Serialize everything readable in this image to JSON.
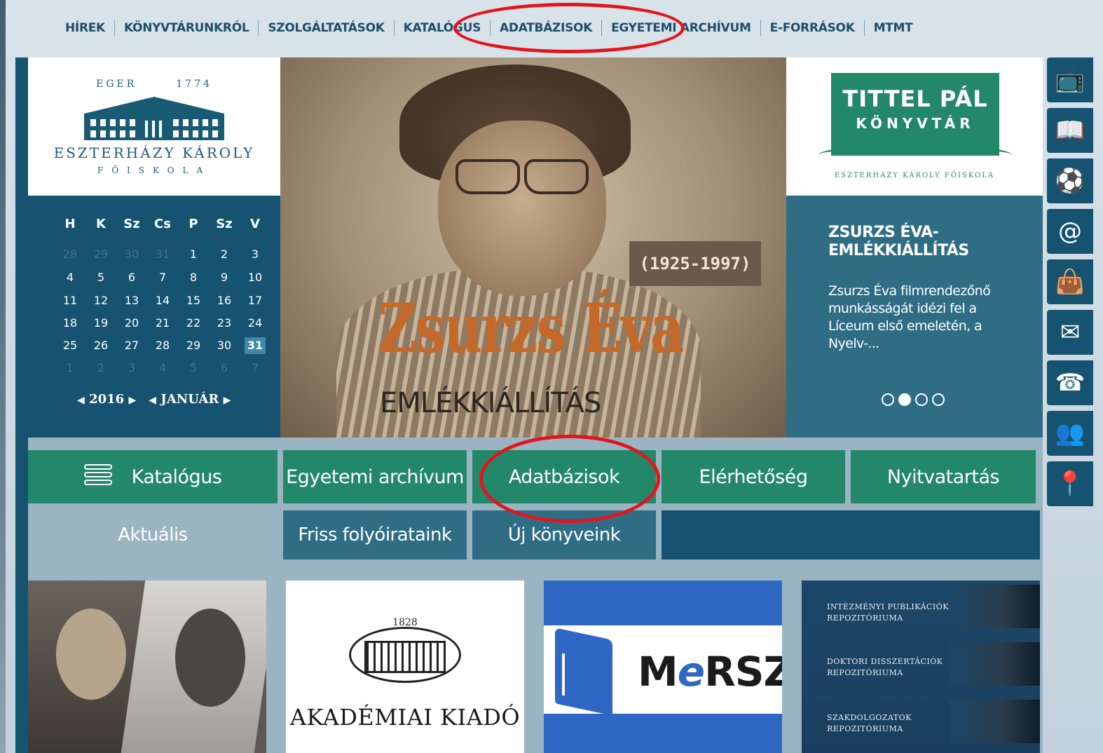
{
  "topnav": {
    "items": [
      "HÍREK",
      "KÖNYVTÁRUNKRÓL",
      "SZOLGÁLTATÁSOK",
      "KATALÓGUS",
      "ADATBÁZISOK",
      "EGYETEMI ARCHÍVUM",
      "E-FORRÁSOK",
      "MTMT"
    ]
  },
  "logo": {
    "city": "EGER",
    "year": "1774",
    "name": "ESZTERHÁZY KÁROLY",
    "subtitle": "FŐISKOLA"
  },
  "calendar": {
    "weekdays": [
      "H",
      "K",
      "Sz",
      "Cs",
      "P",
      "Sz",
      "V"
    ],
    "weeks": [
      [
        "28",
        "29",
        "30",
        "31",
        "1",
        "2",
        "3"
      ],
      [
        "4",
        "5",
        "6",
        "7",
        "8",
        "9",
        "10"
      ],
      [
        "11",
        "12",
        "13",
        "14",
        "15",
        "16",
        "17"
      ],
      [
        "18",
        "19",
        "20",
        "21",
        "22",
        "23",
        "24"
      ],
      [
        "25",
        "26",
        "27",
        "28",
        "29",
        "30",
        "31"
      ],
      [
        "1",
        "2",
        "3",
        "4",
        "5",
        "6",
        "7"
      ]
    ],
    "year": "2016",
    "month": "JANUÁR",
    "today": "31"
  },
  "hero": {
    "years": "(1925-1997)",
    "name": "Zsurzs Éva",
    "subtitle": "EMLÉKKIÁLLÍTÁS"
  },
  "library": {
    "title": "TITTEL PÁL",
    "subtitle": "KÖNYVTÁR",
    "caption": "ESZTERHÁZY KÁROLY FŐISKOLA"
  },
  "news": {
    "title": "ZSURZS ÉVA-EMLÉKKIÁLLÍTÁS",
    "text": "Zsurzs Éva filmrendezőnő munkásságát idézi fel a Líceum első emeletén, a Nyelv-...",
    "dots": 4,
    "active_dot": 1
  },
  "buttons": [
    "Katalógus",
    "Egyetemi archívum",
    "Adatbázisok",
    "Elérhetőség",
    "Nyitvatartás"
  ],
  "tabs": [
    "Aktuális",
    "Friss folyóirataink",
    "Új könyveink"
  ],
  "tiles": {
    "akademiai_year": "1828",
    "akademiai_name": "AKADÉMIAI KIADÓ",
    "mersz_prefix": "M",
    "mersz_e": "e",
    "mersz_suffix": "RSZ",
    "repos": [
      "INTÉZMÉNYI PUBLIKÁCIÓK REPOZITÓRIUMA",
      "DOKTORI DISSZERTÁCIÓK REPOZITÓRIUMA",
      "SZAKDOLGOZATOK REPOZITÓRIUMA"
    ]
  },
  "iconbar": [
    "tv-icon",
    "open-book-icon",
    "ball-icon",
    "snail-icon",
    "shopping-bag-icon",
    "mail-icon",
    "phone-icon",
    "people-icon",
    "location-pin-icon"
  ],
  "colors": {
    "nav_text": "#1d4e6b",
    "dark_teal": "#155370",
    "green": "#23876a",
    "mid_teal": "#2f6d85",
    "highlight_red": "#e5131c",
    "hero_orange": "#c4692a"
  }
}
